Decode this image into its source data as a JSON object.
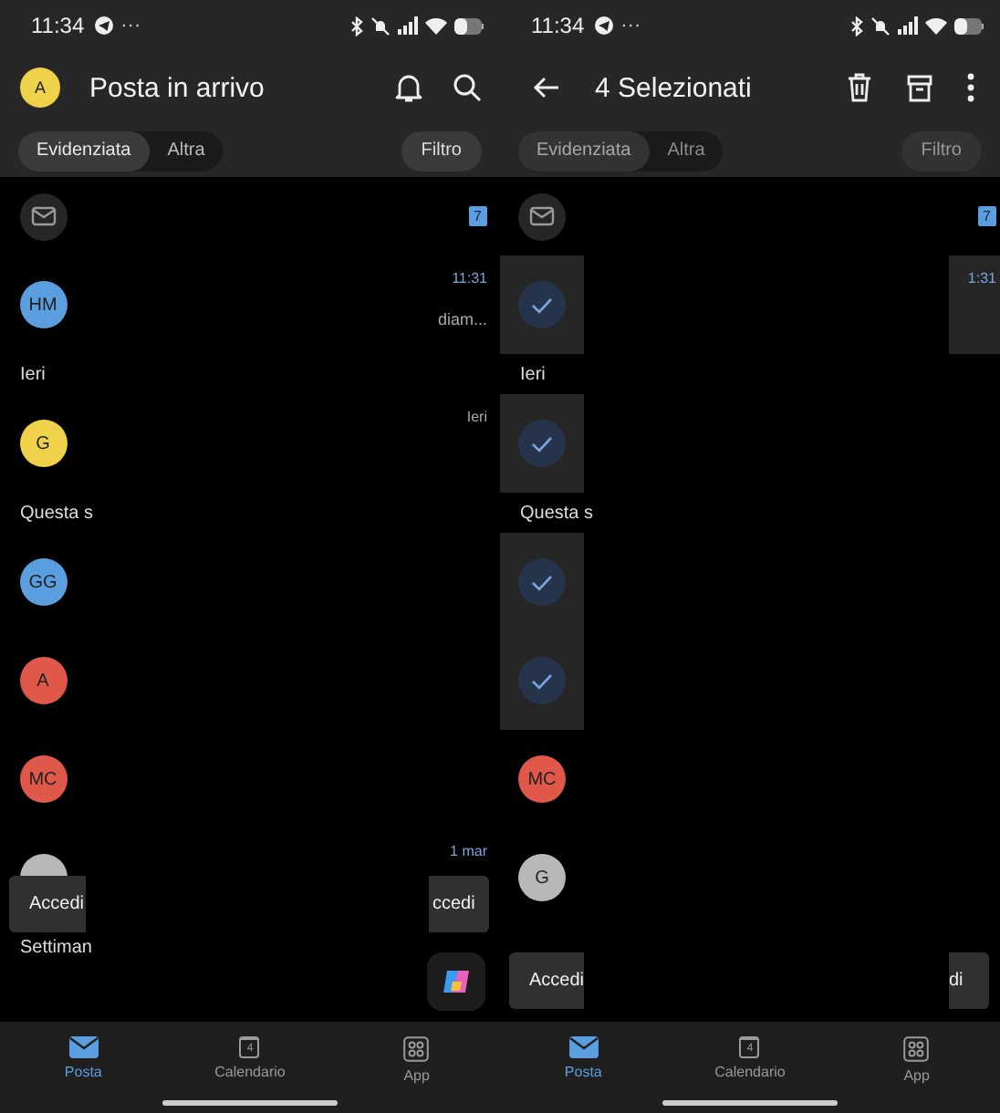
{
  "screens": [
    {
      "status_bar": {
        "time": "11:34",
        "more": "···"
      },
      "header": {
        "kind": "inbox",
        "avatar": "A",
        "title": "Posta in arrivo"
      },
      "tabs": [
        {
          "label": "Evidenziata",
          "selected": true,
          "disabled": false
        },
        {
          "label": "Altra",
          "selected": false,
          "disabled": false
        }
      ],
      "filter": "Filtro",
      "rows": [
        {
          "kind": "folder",
          "badge": "7"
        },
        {
          "kind": "message",
          "initials": "HM",
          "color": "#5b9ee0",
          "selected": false,
          "time": "11:31",
          "unread": true,
          "snippet": "diam..."
        },
        {
          "kind": "section",
          "label": "Ieri"
        },
        {
          "kind": "message",
          "initials": "G",
          "color": "#f0d24a",
          "selected": false,
          "time": "Ieri",
          "unread": false
        },
        {
          "kind": "section",
          "label": "Questa s"
        },
        {
          "kind": "message",
          "initials": "GG",
          "color": "#5b9ee0",
          "selected": false
        },
        {
          "kind": "message",
          "initials": "A",
          "color": "#e0584a",
          "selected": false
        },
        {
          "kind": "message",
          "initials": "MC",
          "color": "#e0584a",
          "selected": false
        },
        {
          "kind": "message",
          "color": "#b8b8b8",
          "selected": false,
          "time": "1 mar",
          "unread": true
        },
        {
          "kind": "section",
          "label": "Settiman"
        }
      ],
      "snackbar": {
        "left": "Accedi",
        "right": "ccedi"
      },
      "copilot": true,
      "nav": [
        {
          "label": "Posta",
          "selected": true,
          "kind": "mail"
        },
        {
          "label": "Calendario",
          "selected": false,
          "kind": "calendar",
          "day": "4"
        },
        {
          "label": "App",
          "selected": false,
          "kind": "apps"
        }
      ]
    },
    {
      "status_bar": {
        "time": "11:34",
        "more": "···"
      },
      "header": {
        "kind": "selection",
        "title": "4 Selezionati"
      },
      "tabs": [
        {
          "label": "Evidenziata",
          "selected": true,
          "disabled": true
        },
        {
          "label": "Altra",
          "selected": false,
          "disabled": true
        }
      ],
      "filter": "Filtro",
      "rows": [
        {
          "kind": "folder",
          "badge": "7"
        },
        {
          "kind": "message",
          "selected": true,
          "time": "1:31",
          "unread": true
        },
        {
          "kind": "section",
          "label": "Ieri"
        },
        {
          "kind": "message",
          "selected": true
        },
        {
          "kind": "section",
          "label": "Questa s"
        },
        {
          "kind": "message",
          "selected": true
        },
        {
          "kind": "message",
          "selected": true
        },
        {
          "kind": "message",
          "initials": "MC",
          "color": "#e0584a",
          "selected": false
        },
        {
          "kind": "message",
          "initials": "G",
          "color": "#b8b8b8",
          "selected": false
        }
      ],
      "snackbar": {
        "left": "Accedi",
        "right": "di"
      },
      "nav": [
        {
          "label": "Posta",
          "selected": true,
          "kind": "mail"
        },
        {
          "label": "Calendario",
          "selected": false,
          "kind": "calendar",
          "day": "4"
        },
        {
          "label": "App",
          "selected": false,
          "kind": "apps"
        }
      ]
    }
  ]
}
